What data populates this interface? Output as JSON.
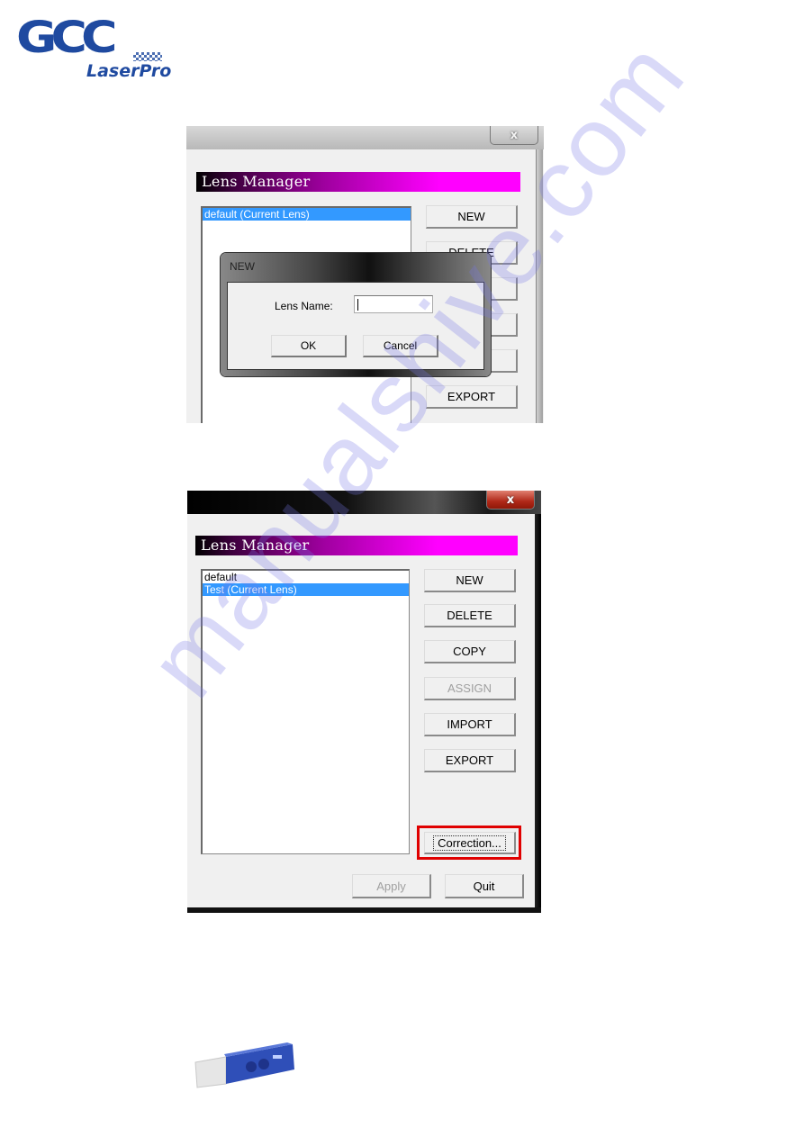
{
  "logo": {
    "brand": "GCC",
    "product": "LaserPro",
    "color": "#1f4aa0"
  },
  "screenshot1": {
    "close_label": "x",
    "banner_title": "Lens Manager",
    "list_items": [
      {
        "label": "default (Current Lens)",
        "selected": true
      }
    ],
    "buttons": [
      "NEW",
      "DELETE",
      "",
      "",
      "",
      "EXPORT"
    ],
    "dialog": {
      "title": "NEW",
      "field_label": "Lens Name:",
      "field_value": "",
      "ok_label": "OK",
      "cancel_label": "Cancel"
    }
  },
  "screenshot2": {
    "close_label": "x",
    "banner_title": "Lens Manager",
    "list_items": [
      {
        "label": "default",
        "selected": false
      },
      {
        "label": "Test (Current Lens)",
        "selected": true
      }
    ],
    "buttons": {
      "new": "NEW",
      "delete": "DELETE",
      "copy": "COPY",
      "assign": "ASSIGN",
      "import": "IMPORT",
      "export": "EXPORT",
      "correction": "Correction...",
      "apply": "Apply",
      "quit": "Quit"
    },
    "highlight_color": "#e00000"
  },
  "watermark": "manualshive.com",
  "colors": {
    "selection": "#3399ff",
    "banner_end": "#ff00ff"
  }
}
